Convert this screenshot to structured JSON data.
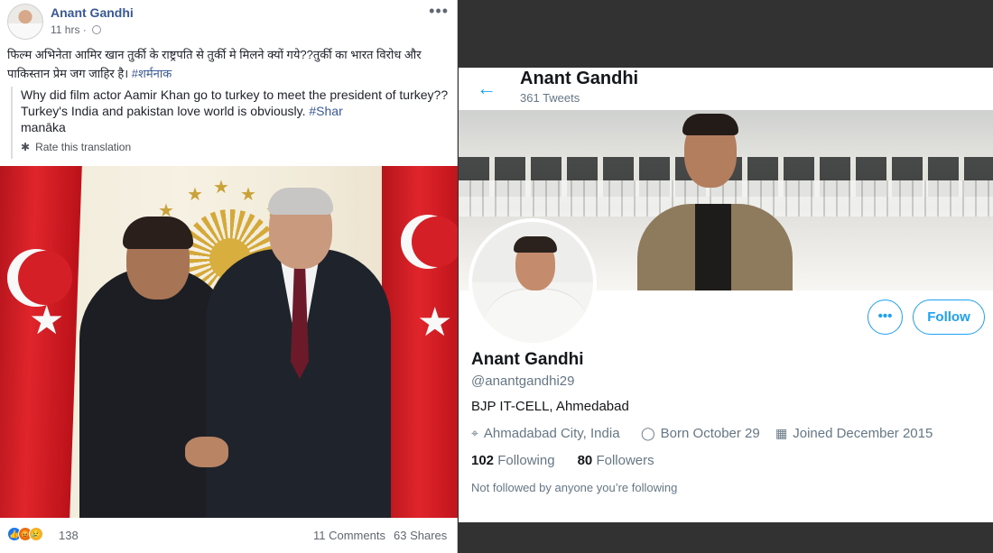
{
  "facebook": {
    "author": "Anant Gandhi",
    "time": "11 hrs · ",
    "more": "•••",
    "post_hindi": "फिल्म अभिनेता आमिर खान तुर्की के राष्ट्रपति से तुर्की मे मिलने क्यों गये??तुर्की का भारत विरोध और पाकिस्तान प्रेम जग जाहिर है।",
    "post_hindi_tag": "#शर्मनाक",
    "translation": "Why did film actor Aamir Khan go to turkey to meet the president of turkey?? Turkey's India and pakistan love world is obviously.",
    "translation_tag": "#Shar",
    "translation_tail": "manāka",
    "rate_translation": "Rate this translation",
    "reaction_count": "138",
    "comments": "11 Comments",
    "shares": "63 Shares"
  },
  "twitter": {
    "header_name": "Anant Gandhi",
    "tweet_count": "361 Tweets",
    "follow_label": "Follow",
    "more_label": "•••",
    "name": "Anant Gandhi",
    "handle": "@anantgandhi29",
    "bio": "BJP IT-CELL, Ahmedabad",
    "location": "Ahmadabad City, India",
    "born": "Born October 29",
    "joined": "Joined December 2015",
    "following_count": "102",
    "following_label": "Following",
    "followers_count": "80",
    "followers_label": "Followers",
    "not_followed": "Not followed by anyone you’re following"
  },
  "colors": {
    "facebook_link": "#385898",
    "twitter_blue": "#1da1f2",
    "background": "#323232"
  },
  "icons": [
    "globe-icon",
    "gear-icon",
    "back-arrow-icon",
    "location-icon",
    "balloon-icon",
    "calendar-icon",
    "like-reaction-icon",
    "angry-reaction-icon",
    "sad-reaction-icon"
  ]
}
